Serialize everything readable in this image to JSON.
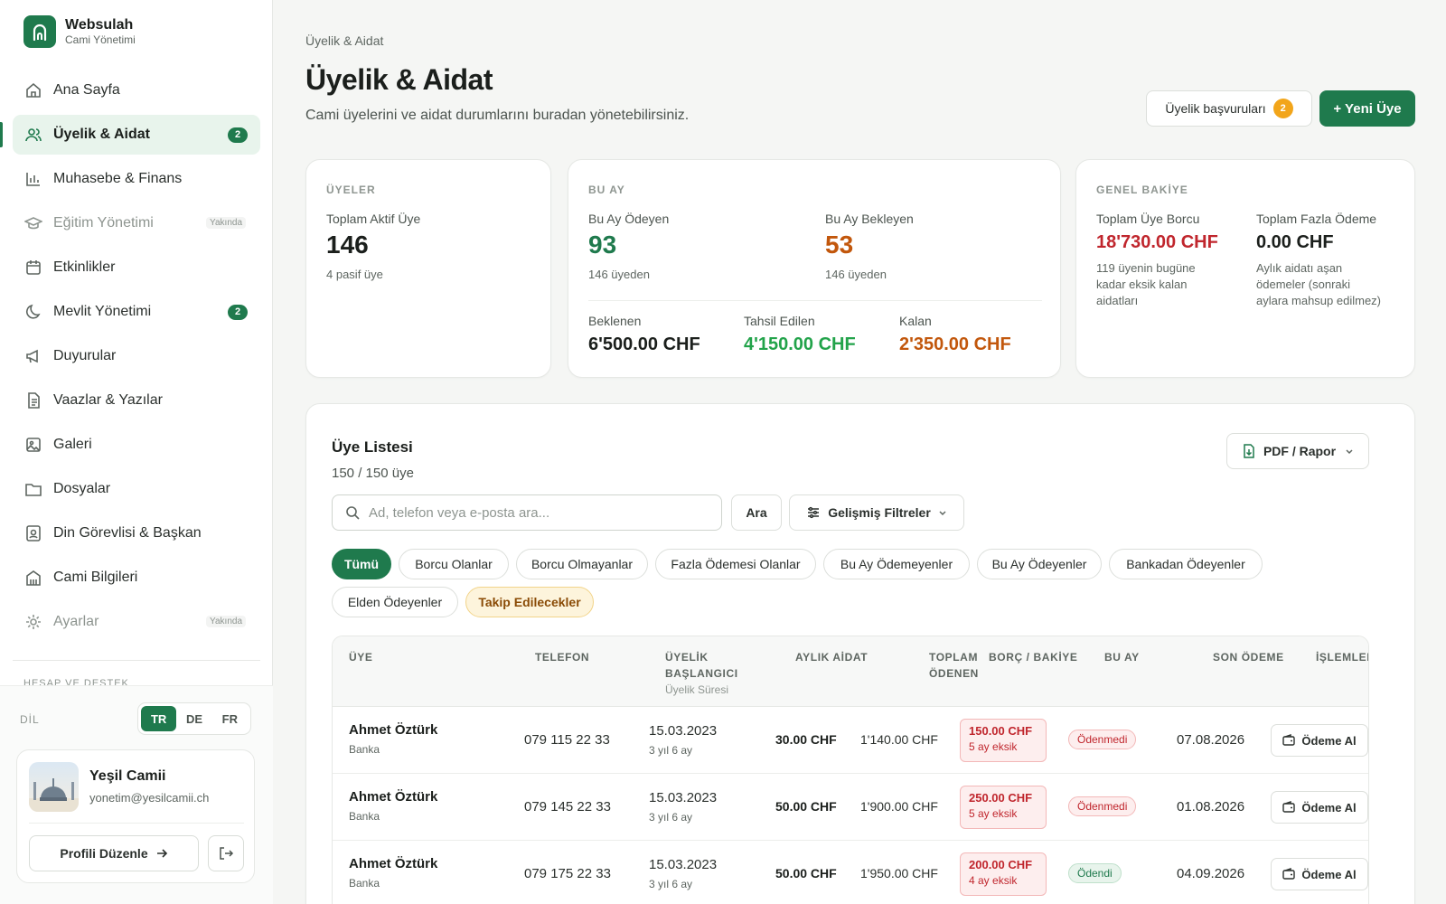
{
  "brand": {
    "name": "Websulah",
    "subtitle": "Cami Yönetimi"
  },
  "nav": [
    {
      "label": "Ana Sayfa",
      "icon": "home-icon"
    },
    {
      "label": "Üyelik & Aidat",
      "icon": "users-icon",
      "badge": "2",
      "active": true
    },
    {
      "label": "Muhasebe & Finans",
      "icon": "bar-chart-icon"
    },
    {
      "label": "Eğitim Yönetimi",
      "icon": "graduation-cap-icon",
      "soon": "Yakında"
    },
    {
      "label": "Etkinlikler",
      "icon": "calendar-icon"
    },
    {
      "label": "Mevlit Yönetimi",
      "icon": "moon-icon",
      "badge": "2"
    },
    {
      "label": "Duyurular",
      "icon": "megaphone-icon"
    },
    {
      "label": "Vaazlar & Yazılar",
      "icon": "document-icon"
    },
    {
      "label": "Galeri",
      "icon": "image-icon"
    },
    {
      "label": "Dosyalar",
      "icon": "folder-icon"
    },
    {
      "label": "Din Görevlisi & Başkan",
      "icon": "id-badge-icon"
    },
    {
      "label": "Cami Bilgileri",
      "icon": "building-icon"
    },
    {
      "label": "Ayarlar",
      "icon": "gear-icon",
      "soon": "Yakında"
    }
  ],
  "sidebar_section": "HESAP VE DESTEK",
  "language": {
    "label": "DİL",
    "options": [
      "TR",
      "DE",
      "FR"
    ],
    "selected": "TR"
  },
  "profile": {
    "name": "Yeşil Camii",
    "email": "yonetim@yesilcamii.ch",
    "edit_label": "Profili Düzenle"
  },
  "breadcrumb": "Üyelik & Aidat",
  "page": {
    "title": "Üyelik & Aidat",
    "subtitle": "Cami üyelerini ve aidat durumlarını buradan yönetebilirsiniz."
  },
  "actions": {
    "applications_label": "Üyelik başvuruları",
    "applications_count": "2",
    "new_member_label": "+ Yeni Üye"
  },
  "stats": {
    "members": {
      "caption": "ÜYELER",
      "label": "Toplam Aktif Üye",
      "value": "146",
      "note": "4 pasif üye"
    },
    "month": {
      "caption": "BU AY",
      "paid_label": "Bu Ay Ödeyen",
      "paid_value": "93",
      "paid_note": "146 üyeden",
      "pending_label": "Bu Ay Bekleyen",
      "pending_value": "53",
      "pending_note": "146 üyeden",
      "expected_label": "Beklenen",
      "expected_value": "6'500.00 CHF",
      "collected_label": "Tahsil Edilen",
      "collected_value": "4'150.00 CHF",
      "remaining_label": "Kalan",
      "remaining_value": "2'350.00 CHF"
    },
    "balance": {
      "caption": "GENEL BAKİYE",
      "debt_label": "Toplam Üye Borcu",
      "debt_value": "18'730.00 CHF",
      "debt_note": "119 üyenin bugüne kadar eksik kalan aidatları",
      "over_label": "Toplam Fazla Ödeme",
      "over_value": "0.00 CHF",
      "over_note": "Aylık aidatı aşan ödemeler (sonraki aylara mahsup edilmez)"
    }
  },
  "list": {
    "title": "Üye Listesi",
    "count": "150 / 150 üye",
    "pdf_label": "PDF / Rapor",
    "search_placeholder": "Ad, telefon veya e-posta ara...",
    "search_button": "Ara",
    "filter_button": "Gelişmiş Filtreler",
    "chips": [
      "Tümü",
      "Borcu Olanlar",
      "Borcu Olmayanlar",
      "Fazla Ödemesi Olanlar",
      "Bu Ay Ödemeyenler",
      "Bu Ay Ödeyenler",
      "Bankadan Ödeyenler",
      "Elden Ödeyenler",
      "Takip Edilecekler"
    ],
    "columns": {
      "member": "ÜYE",
      "phone": "TELEFON",
      "start": "ÜYELİK BAŞLANGICI",
      "start_sub": "Üyelik Süresi",
      "monthly": "AYLIK AİDAT",
      "total": "TOPLAM ÖDENEN",
      "debt": "BORÇ / BAKİYE",
      "month": "BU AY",
      "last": "SON ÖDEME",
      "actions": "İŞLEMLER"
    },
    "rows": [
      {
        "name": "Ahmet Öztürk",
        "method": "Banka",
        "phone": "079 115 22 33",
        "start": "15.03.2023",
        "duration": "3 yıl 6 ay",
        "monthly": "30.00 CHF",
        "total": "1'140.00 CHF",
        "debt": "150.00 CHF",
        "debt_note": "5 ay eksik",
        "status": "Ödenmedi",
        "last": "07.08.2026",
        "action": "Ödeme Al"
      },
      {
        "name": "Ahmet Öztürk",
        "method": "Banka",
        "phone": "079 145 22 33",
        "start": "15.03.2023",
        "duration": "3 yıl 6 ay",
        "monthly": "50.00 CHF",
        "total": "1'900.00 CHF",
        "debt": "250.00 CHF",
        "debt_note": "5 ay eksik",
        "status": "Ödenmedi",
        "last": "01.08.2026",
        "action": "Ödeme Al"
      },
      {
        "name": "Ahmet Öztürk",
        "method": "Banka",
        "phone": "079 175 22 33",
        "start": "15.03.2023",
        "duration": "3 yıl 6 ay",
        "monthly": "50.00 CHF",
        "total": "1'950.00 CHF",
        "debt": "200.00 CHF",
        "debt_note": "4 ay eksik",
        "status": "Ödendi",
        "last": "04.09.2026",
        "action": "Ödeme Al"
      }
    ]
  },
  "colors": {
    "brand": "#1f7a4d",
    "danger": "#c0262d",
    "warning": "#c2570c",
    "success": "#22a34a",
    "badge": "#f2a51a"
  }
}
